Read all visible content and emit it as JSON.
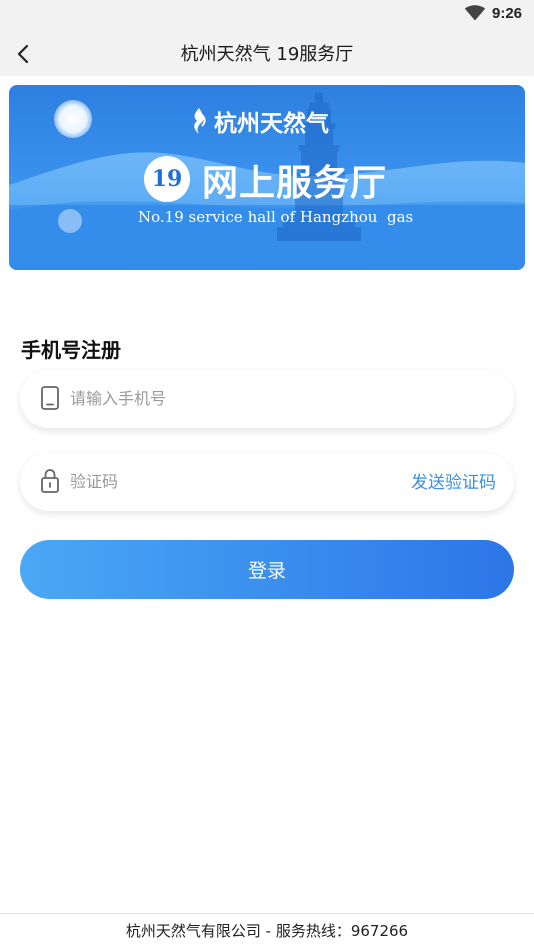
{
  "status_bar": {
    "time": "9:26",
    "icons": [
      "wifi-icon"
    ]
  },
  "header": {
    "back_icon": "chevron-left-icon",
    "title": "杭州天然气 19服务厅"
  },
  "banner": {
    "brand": "杭州天然气",
    "number": "19",
    "title": "网上服务厅",
    "subtitle": "No.19 service hall of Hangzhou  gas"
  },
  "form": {
    "section_title": "手机号注册",
    "phone": {
      "icon": "phone-icon",
      "value": "",
      "placeholder": "请输入手机号"
    },
    "code": {
      "icon": "lock-icon",
      "value": "",
      "placeholder": "验证码",
      "send_label": "发送验证码"
    },
    "login_label": "登录"
  },
  "footer": {
    "text": "杭州天然气有限公司 - 服务热线：967266"
  },
  "colors": {
    "accent": "#3a8fe0",
    "button_start": "#4aa8f5",
    "button_end": "#2c76e8",
    "banner_blue": "#1f6fd8"
  }
}
